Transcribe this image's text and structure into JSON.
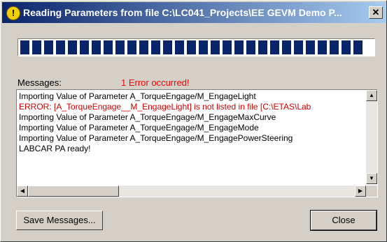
{
  "window": {
    "title": "Reading Parameters from file C:\\LC041_Projects\\EE GEVM Demo P...",
    "close_glyph": "✕",
    "icon": "info-icon"
  },
  "progress": {
    "value": 1.0,
    "color": "#0a246a"
  },
  "messages": {
    "label": "Messages:",
    "error_count": "1 Error occurred!",
    "lines": [
      {
        "text": "Importing Value of Parameter A_TorqueEngage/M_EngageLight",
        "type": "normal"
      },
      {
        "text": "ERROR:  [A_TorqueEngage__M_EngageLight]  is not listed in file [C:\\ETAS\\Lab",
        "type": "error"
      },
      {
        "text": "Importing Value of Parameter A_TorqueEngage/M_EngageMaxCurve",
        "type": "normal"
      },
      {
        "text": "Importing Value of Parameter A_TorqueEngage/M_EngageMode",
        "type": "normal"
      },
      {
        "text": "Importing Value of Parameter A_TorqueEngage/M_EngagePowerSteering",
        "type": "normal"
      },
      {
        "text": "LABCAR PA ready!",
        "type": "normal"
      }
    ]
  },
  "buttons": {
    "save": "Save Messages...",
    "close": "Close"
  },
  "colors": {
    "error": "#d00000",
    "title_start": "#0a246a",
    "title_end": "#a6caf0"
  }
}
